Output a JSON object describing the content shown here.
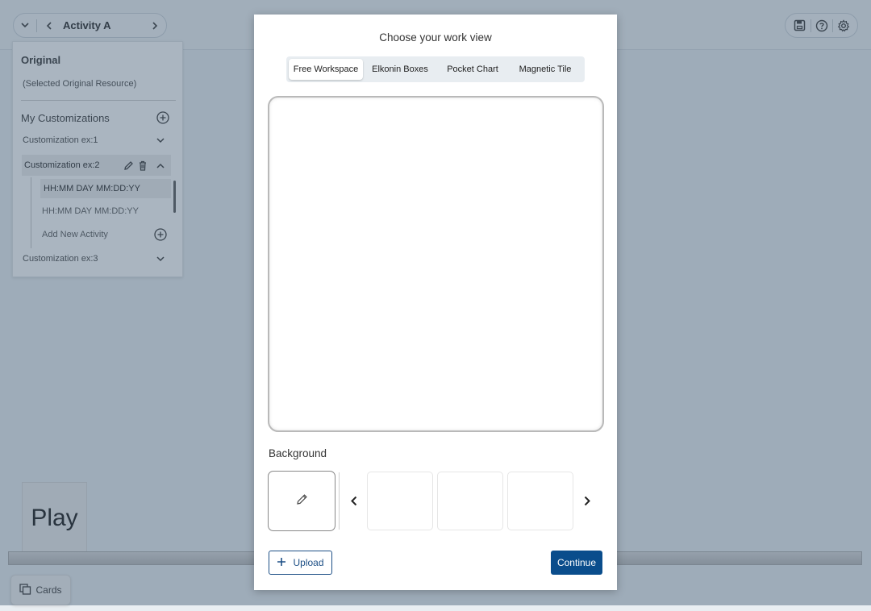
{
  "nav": {
    "activity_title": "Activity A",
    "dropdown_icon": "chevron-down-icon",
    "prev_icon": "chevron-left-icon",
    "next_icon": "chevron-right-icon"
  },
  "toolbar": {
    "icons": [
      "save-icon",
      "help-icon",
      "settings-icon"
    ]
  },
  "sidebar": {
    "original_heading": "Original",
    "original_resource": "(Selected Original Resource)",
    "customizations_heading": "My Customizations",
    "customizations": [
      {
        "label": "Customization ex:1",
        "expanded": false
      },
      {
        "label": "Customization ex:2",
        "expanded": true,
        "activities": [
          "HH:MM DAY MM:DD:YY",
          "HH:MM DAY MM:DD:YY"
        ],
        "add_activity_label": "Add New Activity"
      },
      {
        "label": "Customization ex:3",
        "expanded": false
      }
    ]
  },
  "play_label": "Play",
  "cards_label": "Cards",
  "modal": {
    "title": "Choose your work view",
    "tabs": [
      {
        "label": "Free Workspace",
        "active": true
      },
      {
        "label": "Elkonin Boxes",
        "active": false
      },
      {
        "label": "Pocket Chart",
        "active": false
      },
      {
        "label": "Magnetic Tile",
        "active": false
      }
    ],
    "background_label": "Background",
    "upload_label": "Upload",
    "continue_label": "Continue"
  },
  "colors": {
    "primary": "#0a4d8c",
    "overlay": "#465e76"
  }
}
